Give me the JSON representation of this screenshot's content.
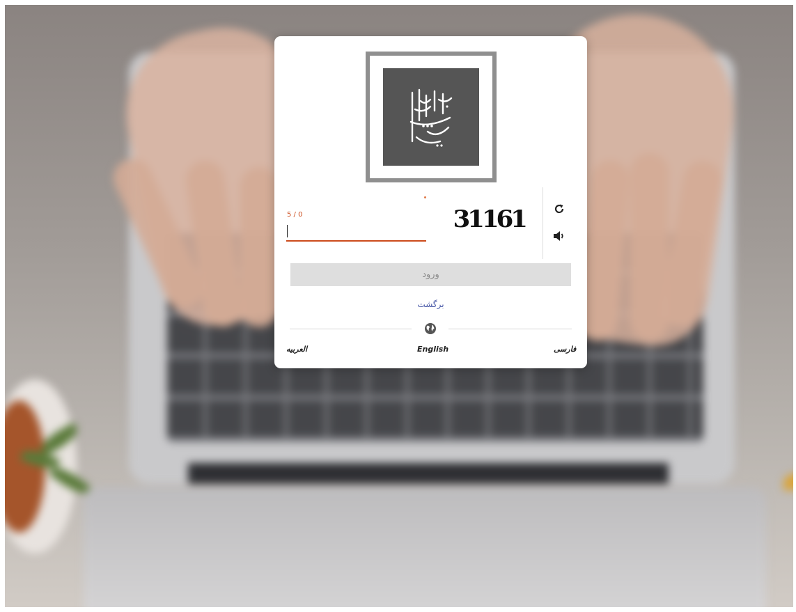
{
  "captcha": {
    "image_text": "31161",
    "counter": "5 / 0",
    "input_value": "",
    "refresh_icon": "refresh-icon",
    "audio_icon": "speaker-icon"
  },
  "login": {
    "button_label": "ورود",
    "back_link": "برگشت"
  },
  "languages": {
    "globe_icon": "globe-icon",
    "items": [
      "العربیه",
      "English",
      "فارسی"
    ]
  },
  "colors": {
    "accent": "#cc4b1c",
    "link": "#4a5aa8",
    "logo_bg": "#555555"
  }
}
